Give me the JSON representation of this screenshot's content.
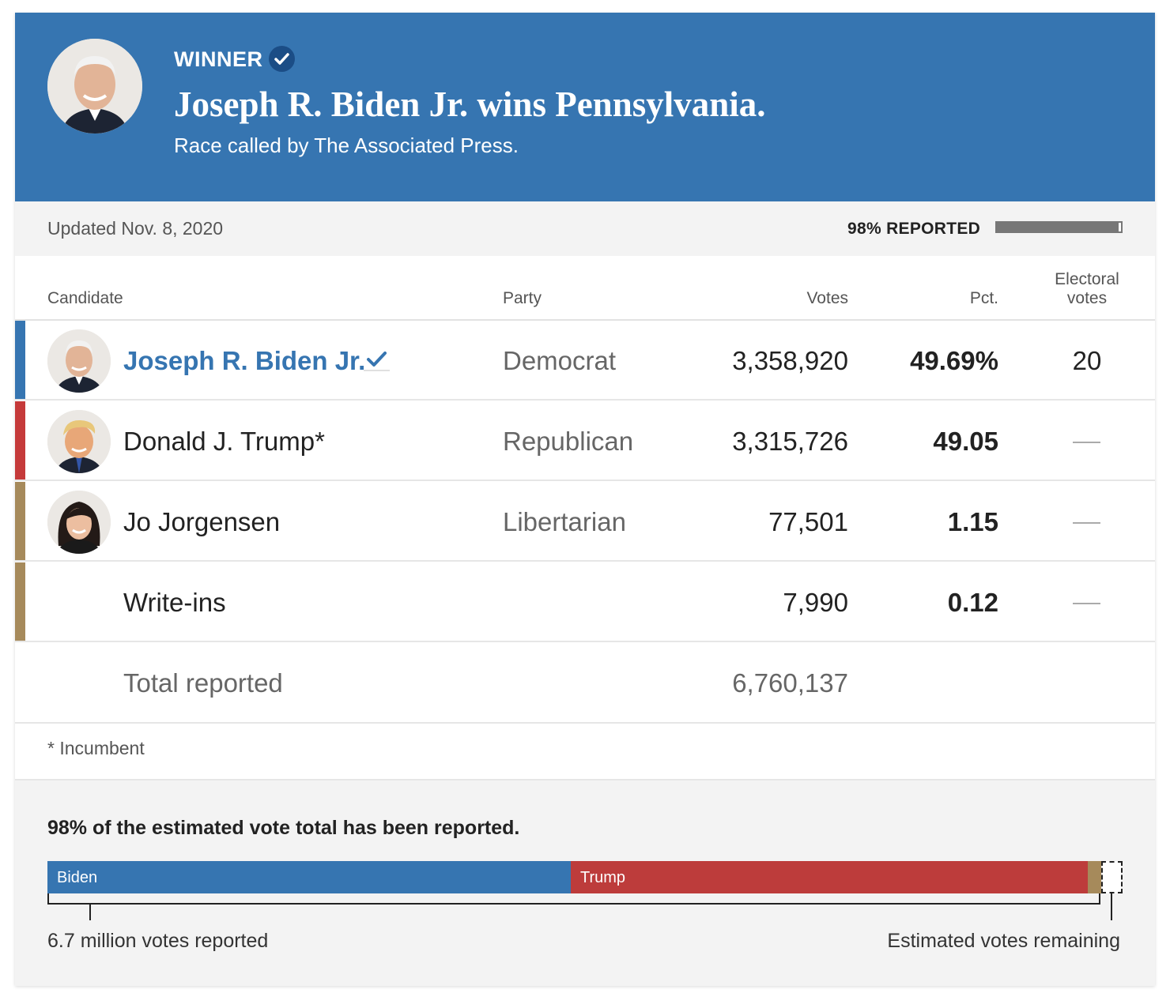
{
  "banner": {
    "winner_label": "WINNER",
    "headline": "Joseph R. Biden Jr. wins Pennsylvania.",
    "subline": "Race called by The Associated Press.",
    "background_color": "#3675b1",
    "check_icon": "check-circle-icon"
  },
  "status": {
    "updated": "Updated Nov. 8, 2020",
    "reported_label": "98% REPORTED",
    "reported_fraction": 0.98
  },
  "table": {
    "headers": {
      "candidate": "Candidate",
      "party": "Party",
      "votes": "Votes",
      "pct": "Pct.",
      "electoral": "Electoral votes"
    },
    "rows": [
      {
        "name": "Joseph R. Biden Jr.",
        "party": "Democrat",
        "votes": "3,358,920",
        "pct": "49.69%",
        "electoral": "20",
        "winner": true,
        "color": "#3675b1",
        "icon": "biden-portrait"
      },
      {
        "name": "Donald J. Trump*",
        "party": "Republican",
        "votes": "3,315,726",
        "pct": "49.05",
        "electoral": "—",
        "winner": false,
        "color": "#c53a3a",
        "icon": "trump-portrait"
      },
      {
        "name": "Jo Jorgensen",
        "party": "Libertarian",
        "votes": "77,501",
        "pct": "1.15",
        "electoral": "—",
        "winner": false,
        "color": "#a68a5b",
        "icon": "jorgensen-portrait"
      },
      {
        "name": "Write-ins",
        "party": "",
        "votes": "7,990",
        "pct": "0.12",
        "electoral": "—",
        "winner": false,
        "color": "#a68a5b",
        "icon": ""
      }
    ],
    "total_label": "Total reported",
    "total_votes": "6,760,137"
  },
  "footnote": "* Incumbent",
  "progress": {
    "headline": "98% of the estimated vote total has been reported.",
    "segments": [
      {
        "label": "Biden",
        "share": 0.4869,
        "color": "#3675b1"
      },
      {
        "label": "Trump",
        "share": 0.4806,
        "color": "#bd3c3b"
      },
      {
        "label": "",
        "share": 0.0125,
        "color": "#a68a5b"
      }
    ],
    "remaining_share": 0.02,
    "left_note": "6.7 million votes reported",
    "right_note": "Estimated votes remaining"
  }
}
